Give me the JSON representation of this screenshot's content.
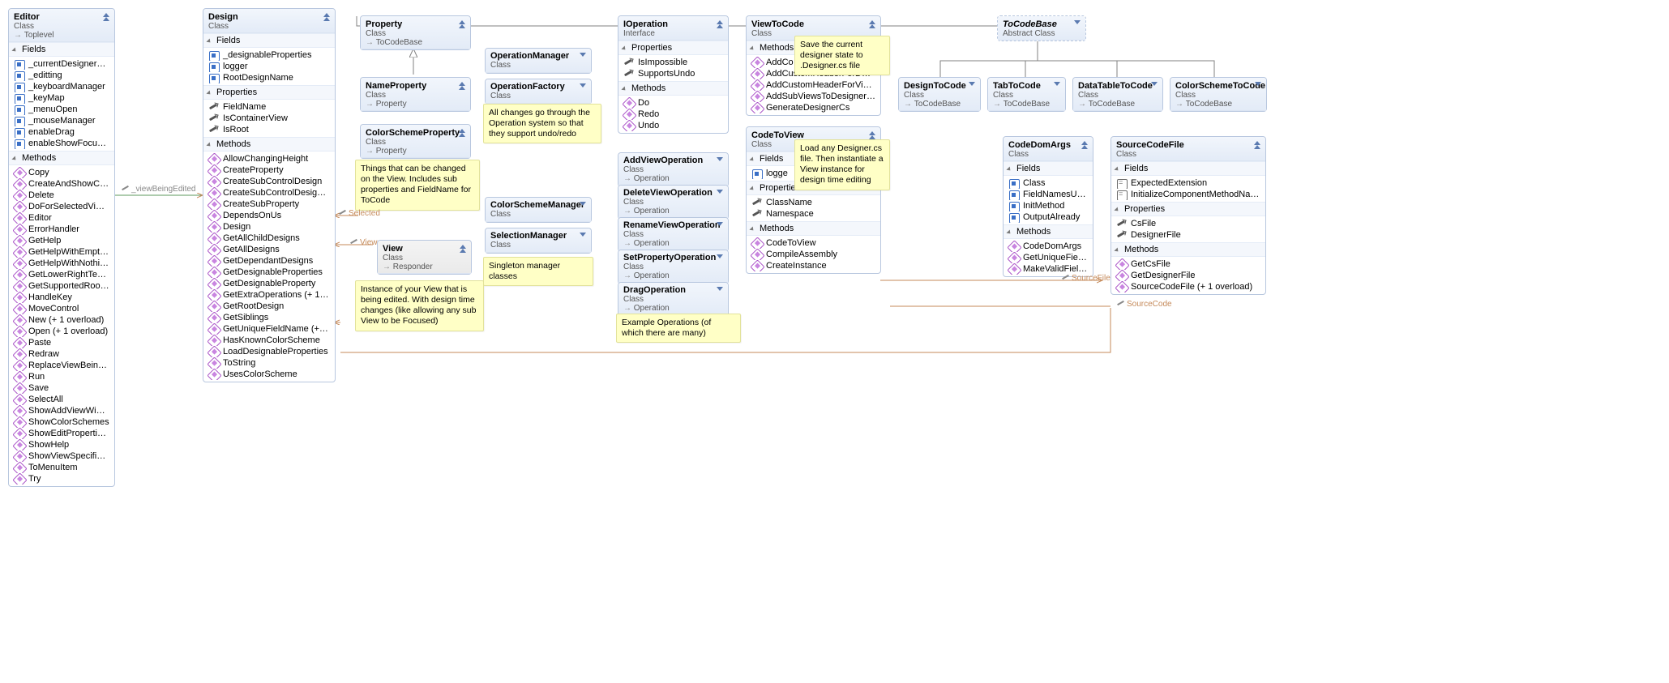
{
  "editor": {
    "title": "Editor",
    "sub": "Class",
    "base": "Toplevel",
    "sections": [
      {
        "label": "Fields",
        "kind": "field",
        "items": [
          "_currentDesignerFile",
          "_editting",
          "_keyboardManager",
          "_keyMap",
          "_menuOpen",
          "_mouseManager",
          "enableDrag",
          "enableShowFocused"
        ]
      },
      {
        "label": "Methods",
        "kind": "method",
        "items": [
          "Copy",
          "CreateAndShowCon…",
          "Delete",
          "DoForSelectedViews",
          "Editor",
          "ErrorHandler",
          "GetHelp",
          "GetHelpWithEmpty…",
          "GetHelpWithNothin…",
          "GetLowerRightTextIf…",
          "GetSupportedRoot…",
          "HandleKey",
          "MoveControl",
          "New (+ 1 overload)",
          "Open (+ 1 overload)",
          "Paste",
          "Redraw",
          "ReplaceViewBeingE…",
          "Run",
          "Save",
          "SelectAll",
          "ShowAddViewWind…",
          "ShowColorSchemes",
          "ShowEditProperties…",
          "ShowHelp",
          "ShowViewSpecificO…",
          "ToMenuItem",
          "Try"
        ]
      }
    ]
  },
  "design": {
    "title": "Design",
    "sub": "Class",
    "sections": [
      {
        "label": "Fields",
        "kind": "field",
        "items": [
          "_designableProperties",
          "logger",
          "RootDesignName"
        ]
      },
      {
        "label": "Properties",
        "kind": "prop",
        "items": [
          "FieldName",
          "IsContainerView",
          "IsRoot"
        ]
      },
      {
        "label": "Methods",
        "kind": "method",
        "items": [
          "AllowChangingHeight",
          "CreateProperty",
          "CreateSubControlDesign",
          "CreateSubControlDesigns  (+…",
          "CreateSubProperty",
          "DependsOnUs",
          "Design",
          "GetAllChildDesigns",
          "GetAllDesigns",
          "GetDependantDesigns",
          "GetDesignableProperties",
          "GetDesignableProperty",
          "GetExtraOperations (+ 1 ove…",
          "GetRootDesign",
          "GetSiblings",
          "GetUniqueFieldName (+ 1 o…",
          "HasKnownColorScheme",
          "LoadDesignableProperties",
          "ToString",
          "UsesColorScheme"
        ]
      }
    ]
  },
  "property": {
    "title": "Property",
    "sub": "Class",
    "base": "ToCodeBase"
  },
  "nameProperty": {
    "title": "NameProperty",
    "sub": "Class",
    "base": "Property"
  },
  "colorSchemeProperty": {
    "title": "ColorSchemeProperty",
    "sub": "Class",
    "base": "Property"
  },
  "view": {
    "title": "View",
    "sub": "Class",
    "base": "Responder"
  },
  "operationManager": {
    "title": "OperationManager",
    "sub": "Class"
  },
  "operationFactory": {
    "title": "OperationFactory",
    "sub": "Class"
  },
  "colorSchemeManager": {
    "title": "ColorSchemeManager",
    "sub": "Class"
  },
  "selectionManager": {
    "title": "SelectionManager",
    "sub": "Class"
  },
  "iOperation": {
    "title": "IOperation",
    "sub": "Interface",
    "sections": [
      {
        "label": "Properties",
        "kind": "prop",
        "items": [
          "IsImpossible",
          "SupportsUndo"
        ]
      },
      {
        "label": "Methods",
        "kind": "method",
        "items": [
          "Do",
          "Redo",
          "Undo"
        ]
      }
    ]
  },
  "ops": [
    {
      "title": "AddViewOperation",
      "sub": "Class",
      "base": "Operation"
    },
    {
      "title": "DeleteViewOperation",
      "sub": "Class",
      "base": "Operation"
    },
    {
      "title": "RenameViewOperation",
      "sub": "Class",
      "base": "Operation"
    },
    {
      "title": "SetPropertyOperation",
      "sub": "Class",
      "base": "Operation"
    },
    {
      "title": "DragOperation",
      "sub": "Class",
      "base": "Operation"
    }
  ],
  "viewToCode": {
    "title": "ViewToCode",
    "sub": "Class",
    "sections": [
      {
        "label": "Methods",
        "kind": "method",
        "items": [
          "AddCo",
          "AddCustomHeaderForDesig…",
          "AddCustomHeaderForViewFile",
          "AddSubViewsToDesignerCs",
          "GenerateDesignerCs"
        ]
      }
    ]
  },
  "codeToView": {
    "title": "CodeToView",
    "sub": "Class",
    "sections": [
      {
        "label": "Fields",
        "kind": "field",
        "items": [
          "logge"
        ]
      },
      {
        "label": "Properties",
        "kind": "prop",
        "items": [
          "ClassName",
          "Namespace"
        ]
      },
      {
        "label": "Methods",
        "kind": "method",
        "items": [
          "CodeToView",
          "CompileAssembly",
          "CreateInstance"
        ]
      }
    ]
  },
  "toCodeBase": {
    "title": "ToCodeBase",
    "sub": "Abstract Class"
  },
  "designToCode": {
    "title": "DesignToCode",
    "sub": "Class",
    "base": "ToCodeBase"
  },
  "tabToCode": {
    "title": "TabToCode",
    "sub": "Class",
    "base": "ToCodeBase"
  },
  "dataTableToCode": {
    "title": "DataTableToCode",
    "sub": "Class",
    "base": "ToCodeBase"
  },
  "colorSchemeToCode": {
    "title": "ColorSchemeToCode",
    "sub": "Class",
    "base": "ToCodeBase"
  },
  "codeDomArgs": {
    "title": "CodeDomArgs",
    "sub": "Class",
    "sections": [
      {
        "label": "Fields",
        "kind": "field",
        "items": [
          "Class",
          "FieldNamesUsed",
          "InitMethod",
          "OutputAlready"
        ]
      },
      {
        "label": "Methods",
        "kind": "method",
        "items": [
          "CodeDomArgs",
          "GetUniqueField…",
          "MakeValidField…"
        ]
      }
    ]
  },
  "sourceCodeFile": {
    "title": "SourceCodeFile",
    "sub": "Class",
    "sections": [
      {
        "label": "Fields",
        "kind": "const",
        "items": [
          "ExpectedExtension",
          "InitializeComponentMethodName"
        ]
      },
      {
        "label": "Properties",
        "kind": "prop",
        "items": [
          "CsFile",
          "DesignerFile"
        ]
      },
      {
        "label": "Methods",
        "kind": "method",
        "items": [
          "GetCsFile",
          "GetDesignerFile",
          "SourceCodeFile (+ 1 overload)"
        ]
      }
    ]
  },
  "notes": {
    "propNote": "Things that can be changed on the View.  Includes sub properties and FieldName for ToCode",
    "viewNote": "Instance of your View that is being edited.  With design time changes (like allowing any sub View to be Focused)",
    "opFactoryNote": "All changes go through the Operation system so that they support undo/redo",
    "managersNote": "Singleton manager classes",
    "exampleOpsNote": "Example Operations (of which there are many)",
    "viewToCodeNote": "Save the current designer state to .Designer.cs file",
    "codeToViewNote": "Load any Designer.cs file.  Then instantiate a View instance for design time editing"
  },
  "labels": {
    "viewBeingEdited": "_viewBeingEdited",
    "selected": "Selected",
    "view": "View",
    "sourceFile": "SourceFile",
    "sourceCode": "SourceCode"
  }
}
